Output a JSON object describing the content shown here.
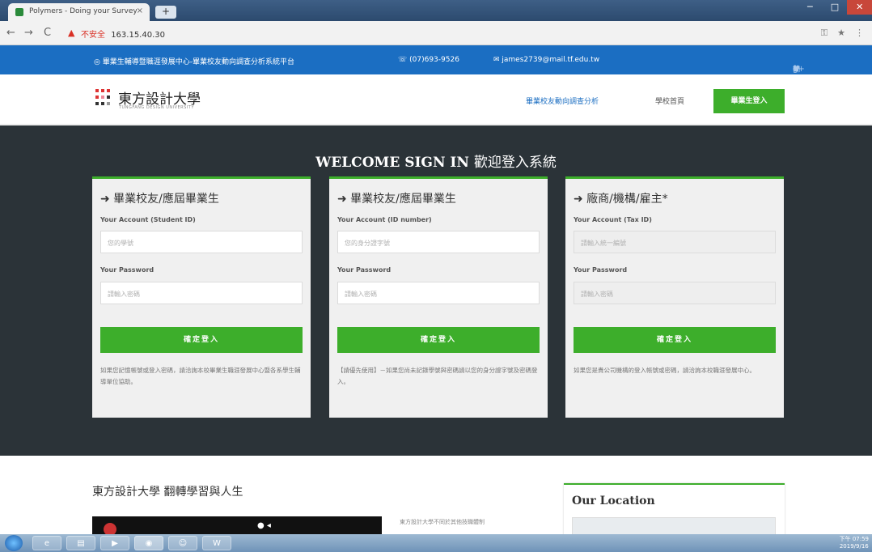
{
  "browser": {
    "tab_title": "Polymers - Doing your Survey",
    "tab_close": "×",
    "new_tab": "+",
    "back": "←",
    "forward": "→",
    "reload": "C",
    "not_secure": "不安全",
    "url": "163.15.40.30",
    "window_min": "─",
    "window_max": "□",
    "window_close": "✕",
    "right_icons": [
      "⚿",
      "★",
      "⋮"
    ]
  },
  "topbar": {
    "org": "◎ 畢業生輔導暨職涯發展中心-畢業校友動向調查分析系統平台",
    "phone": "☏ (07)693-9526",
    "email": "✉ james2739@mail.tf.edu.tw",
    "social": [
      "♥",
      "f",
      "g+",
      "▣",
      "◠"
    ]
  },
  "header": {
    "logo_title": "東方設計大學",
    "logo_sub": "TUNGFANG DESIGN UNIVERSITY",
    "menu_survey": "畢業校友動向調查分析",
    "menu_home": "學校首頁",
    "login": "畢業生登入"
  },
  "hero": {
    "welcome_en": "WELCOME SIGN IN",
    "welcome_zh": "歡迎登入系統",
    "cards": [
      {
        "title": "➜ 畢業校友/應屆畢業生",
        "account_label": "Your Account (Student ID)",
        "account_placeholder": "您的學號",
        "password_label": "Your Password",
        "password_placeholder": "請輸入密碼",
        "button": "確定登入",
        "note": "如果您記憶帳號或登入密碼，請洽詢本校畢業生職涯發展中心暨各系學生輔導單位協助。"
      },
      {
        "title": "➜ 畢業校友/應屆畢業生",
        "account_label": "Your Account (ID number)",
        "account_placeholder": "您的身分證字號",
        "password_label": "Your Password",
        "password_placeholder": "請輸入密碼",
        "button": "確定登入",
        "note": "【請優先使用】－如果您尚未記錄學號與密碼請以您的身分證字號及密碼登入。"
      },
      {
        "title": "➜ 廠商/機構/雇主*",
        "account_label": "Your Account (Tax ID)",
        "account_placeholder": "請輸入統一編號",
        "password_label": "Your Password",
        "password_placeholder": "請輸入密碼",
        "button": "確定登入",
        "note": "如果您是貴公司機構的登入帳號或密碼，請洽詢本校職涯發展中心。"
      }
    ]
  },
  "lower": {
    "section_title": "東方設計大學 翻轉學習與人生",
    "side_text": "東方設計大學不同於其他技職體制",
    "location_title": "Our Location"
  },
  "taskbar": {
    "apps": [
      "e",
      "▤",
      "▶",
      "◉",
      "☺",
      "W"
    ],
    "time": "下午 07:59",
    "date": "2019/9/16"
  }
}
